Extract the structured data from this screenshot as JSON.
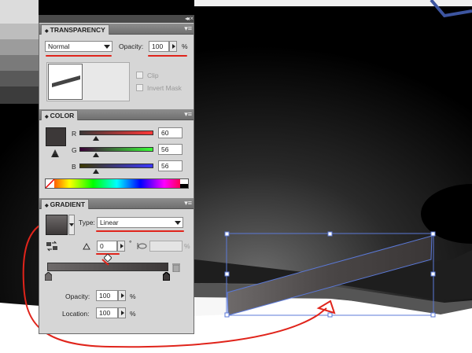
{
  "transparency": {
    "title": "TRANSPARENCY",
    "blend_mode": "Normal",
    "opacity_label": "Opacity:",
    "opacity_value": "100",
    "percent": "%",
    "clip_label": "Clip",
    "invert_mask_label": "Invert Mask"
  },
  "color": {
    "title": "COLOR",
    "r_label": "R",
    "r_value": "60",
    "g_label": "G",
    "g_value": "56",
    "b_label": "B",
    "b_value": "56",
    "swatch": "#3c3838"
  },
  "gradient": {
    "title": "GRADIENT",
    "type_label": "Type:",
    "type_value": "Linear",
    "angle_value": "0",
    "degree": "°",
    "aspect_percent": "%",
    "opacity_label": "Opacity:",
    "opacity_value": "100",
    "location_label": "Location:",
    "location_value": "100",
    "percent": "%"
  },
  "icons": [
    "collapse-icon",
    "close-icon",
    "panel-menu-icon",
    "angle-icon",
    "aspect-ratio-icon",
    "reverse-gradient-icon",
    "trash-icon"
  ],
  "accent_colors": {
    "annotation": "#e0241b",
    "selection": "#5b79d8"
  }
}
